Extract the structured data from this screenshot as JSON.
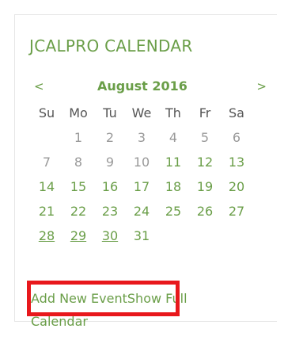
{
  "widget": {
    "title": "JCALPRO CALENDAR"
  },
  "calendar": {
    "prev_label": "<",
    "next_label": ">",
    "month_title": "August 2016",
    "weekdays": [
      "Su",
      "Mo",
      "Tu",
      "We",
      "Th",
      "Fr",
      "Sa"
    ],
    "weeks": [
      [
        null,
        "1",
        "2",
        "3",
        "4",
        "5",
        "6"
      ],
      [
        "7",
        "8",
        "9",
        "10",
        "11",
        "12",
        "13"
      ],
      [
        "14",
        "15",
        "16",
        "17",
        "18",
        "19",
        "20"
      ],
      [
        "21",
        "22",
        "23",
        "24",
        "25",
        "26",
        "27"
      ],
      [
        "28",
        "29",
        "30",
        "31",
        null,
        null,
        null
      ]
    ]
  },
  "links": {
    "add_event": "Add New Event",
    "show_full": "Show Full",
    "show_full_cont": "Calendar"
  },
  "colors": {
    "accent": "#6a9e48",
    "muted_day": "#999999",
    "weekday_header": "#555555",
    "highlight": "#e8181c",
    "border": "#e6e6e6"
  }
}
